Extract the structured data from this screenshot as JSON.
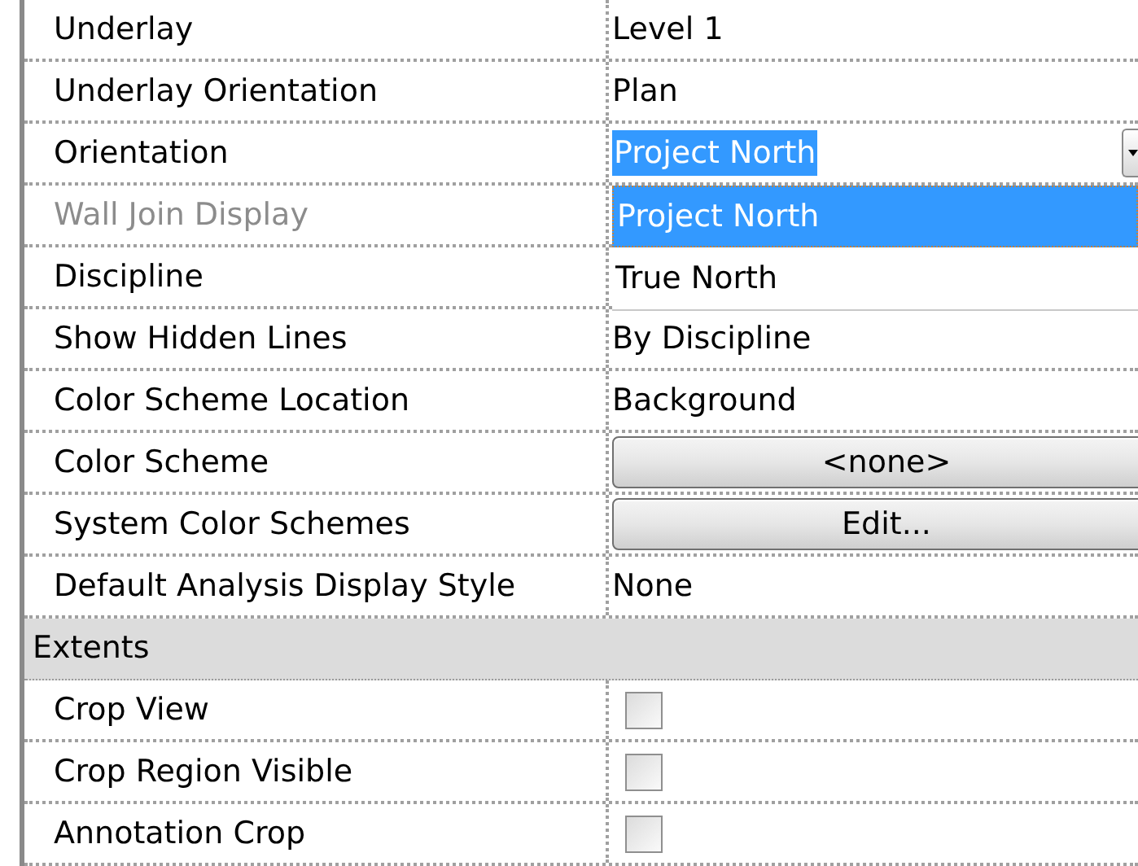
{
  "rows": [
    {
      "kind": "text",
      "label": "Underlay",
      "value": "Level 1",
      "disabled": false
    },
    {
      "kind": "text",
      "label": "Underlay Orientation",
      "value": "Plan",
      "disabled": false
    },
    {
      "kind": "dropdown",
      "label": "Orientation",
      "value": "Project North",
      "disabled": false,
      "expanded": true,
      "options": [
        {
          "label": "Project North",
          "selected": true
        },
        {
          "label": "True North",
          "selected": false
        }
      ]
    },
    {
      "kind": "text",
      "label": "Wall Join Display",
      "disabled": true
    },
    {
      "kind": "text",
      "label": "Discipline",
      "disabled": false
    },
    {
      "kind": "text",
      "label": "Show Hidden Lines",
      "value": "By Discipline",
      "disabled": false
    },
    {
      "kind": "text",
      "label": "Color Scheme Location",
      "value": "Background",
      "disabled": false
    },
    {
      "kind": "button",
      "label": "Color Scheme",
      "value": "<none>",
      "disabled": false
    },
    {
      "kind": "button",
      "label": "System Color Schemes",
      "value": "Edit...",
      "disabled": false
    },
    {
      "kind": "text",
      "label": "Default Analysis Display Style",
      "value": "None",
      "disabled": false
    },
    {
      "kind": "header",
      "label": "Extents"
    },
    {
      "kind": "checkbox",
      "label": "Crop View",
      "checked": false,
      "disabled": false
    },
    {
      "kind": "checkbox",
      "label": "Crop Region Visible",
      "checked": false,
      "disabled": false
    },
    {
      "kind": "checkbox",
      "label": "Annotation Crop",
      "checked": false,
      "disabled": false
    }
  ]
}
